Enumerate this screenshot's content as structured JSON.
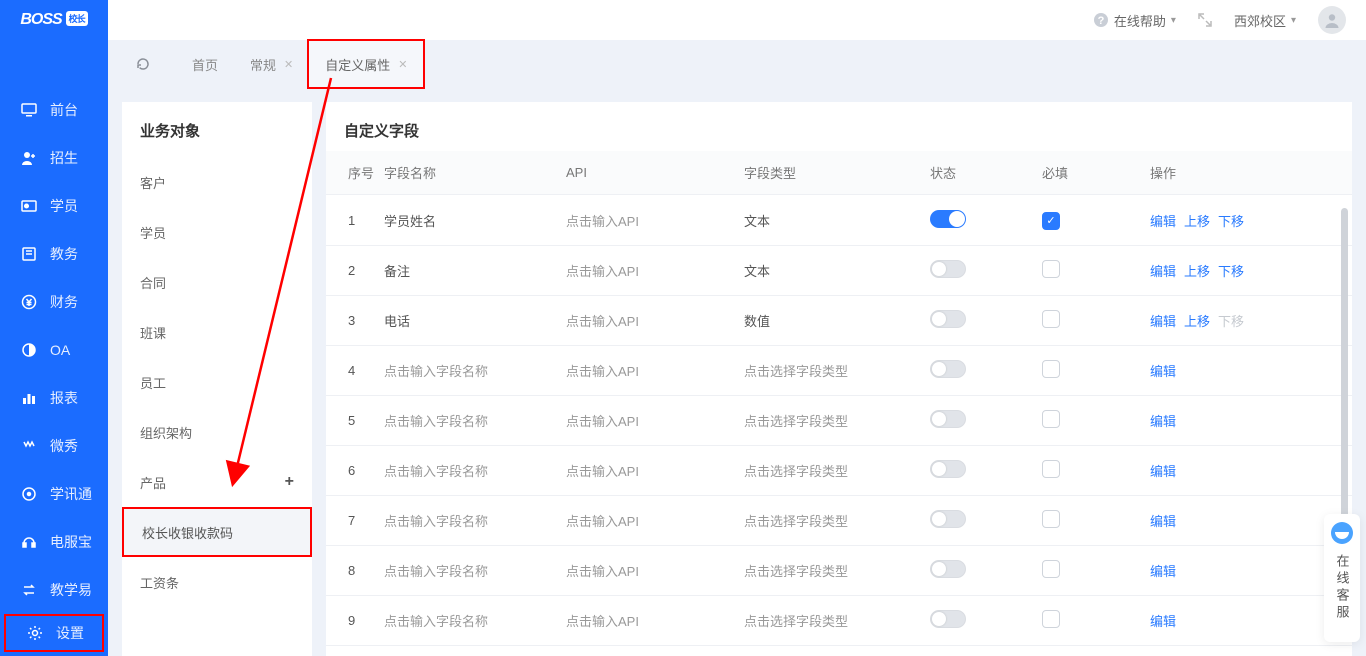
{
  "brand": {
    "name": "BOSS",
    "badge": "校长"
  },
  "header": {
    "help_label": "在线帮助",
    "campus_label": "西郊校区"
  },
  "sidebar": {
    "items": [
      {
        "label": "前台"
      },
      {
        "label": "招生"
      },
      {
        "label": "学员"
      },
      {
        "label": "教务"
      },
      {
        "label": "财务"
      },
      {
        "label": "OA"
      },
      {
        "label": "报表"
      },
      {
        "label": "微秀"
      },
      {
        "label": "学讯通"
      },
      {
        "label": "电服宝"
      },
      {
        "label": "教学易"
      },
      {
        "label": "设置"
      }
    ]
  },
  "tabs": {
    "items": [
      {
        "label": "首页",
        "closable": false
      },
      {
        "label": "常规",
        "closable": true
      },
      {
        "label": "自定义属性",
        "closable": true,
        "active": true
      }
    ]
  },
  "biz_panel": {
    "title": "业务对象",
    "items": [
      {
        "label": "客户"
      },
      {
        "label": "学员"
      },
      {
        "label": "合同"
      },
      {
        "label": "班课"
      },
      {
        "label": "员工"
      },
      {
        "label": "组织架构"
      },
      {
        "label": "产品",
        "addable": true
      },
      {
        "label": "校长收银收款码",
        "selected": true
      },
      {
        "label": "工资条"
      }
    ]
  },
  "fields": {
    "title": "自定义字段",
    "columns": {
      "index": "序号",
      "name": "字段名称",
      "api": "API",
      "type": "字段类型",
      "status": "状态",
      "required": "必填",
      "ops": "操作"
    },
    "placeholders": {
      "name": "点击输入字段名称",
      "api": "点击输入API",
      "type": "点击选择字段类型"
    },
    "op_labels": {
      "edit": "编辑",
      "up": "上移",
      "down": "下移"
    },
    "rows": [
      {
        "idx": "1",
        "name": "学员姓名",
        "api": "",
        "type": "文本",
        "status_on": true,
        "required_on": true,
        "ops": [
          "edit",
          "up",
          "down"
        ],
        "down_disabled": false
      },
      {
        "idx": "2",
        "name": "备注",
        "api": "",
        "type": "文本",
        "status_on": false,
        "required_on": false,
        "ops": [
          "edit",
          "up",
          "down"
        ],
        "down_disabled": false
      },
      {
        "idx": "3",
        "name": "电话",
        "api": "",
        "type": "数值",
        "status_on": false,
        "required_on": false,
        "ops": [
          "edit",
          "up",
          "down"
        ],
        "down_disabled": true
      },
      {
        "idx": "4",
        "name": "",
        "api": "",
        "type": "",
        "status_on": false,
        "required_on": false,
        "ops": [
          "edit"
        ]
      },
      {
        "idx": "5",
        "name": "",
        "api": "",
        "type": "",
        "status_on": false,
        "required_on": false,
        "ops": [
          "edit"
        ]
      },
      {
        "idx": "6",
        "name": "",
        "api": "",
        "type": "",
        "status_on": false,
        "required_on": false,
        "ops": [
          "edit"
        ]
      },
      {
        "idx": "7",
        "name": "",
        "api": "",
        "type": "",
        "status_on": false,
        "required_on": false,
        "ops": [
          "edit"
        ]
      },
      {
        "idx": "8",
        "name": "",
        "api": "",
        "type": "",
        "status_on": false,
        "required_on": false,
        "ops": [
          "edit"
        ]
      },
      {
        "idx": "9",
        "name": "",
        "api": "",
        "type": "",
        "status_on": false,
        "required_on": false,
        "ops": [
          "edit"
        ]
      }
    ]
  },
  "float_help": {
    "label": "在线客服"
  }
}
